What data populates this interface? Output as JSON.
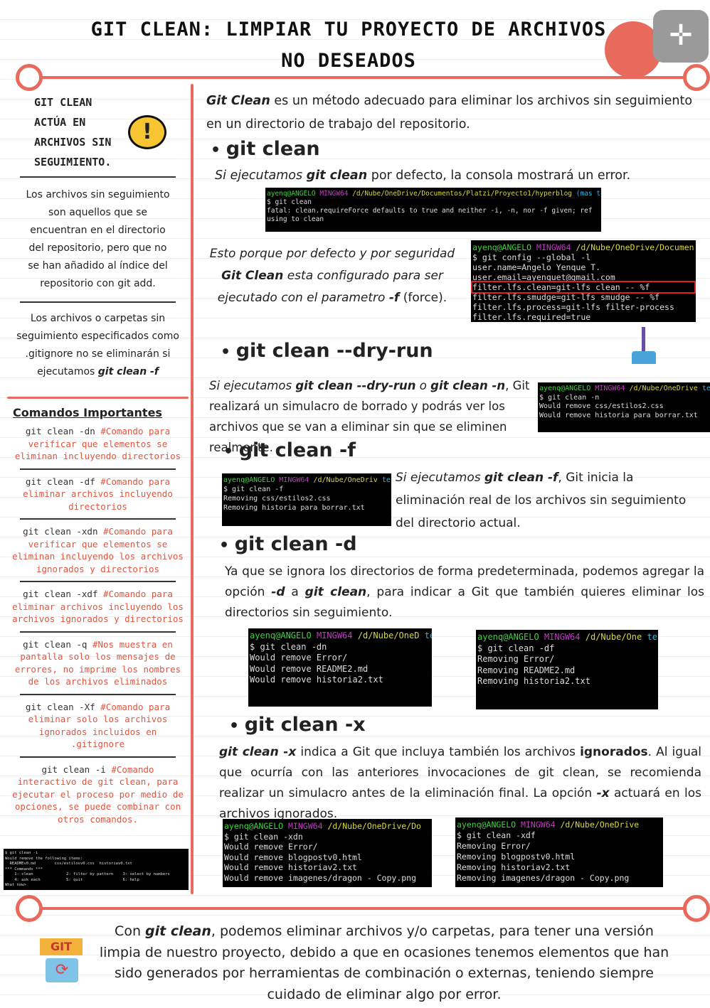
{
  "title": "GIT CLEAN: LIMPIAR TU PROYECTO DE ARCHIVOS NO DESEADOS",
  "colors": {
    "accent": "#e86a5c",
    "comment": "#e0553f",
    "terminal_bg": "#000000",
    "highlight_box": "#e02020"
  },
  "left": {
    "heading": "GIT CLEAN ACTÚA EN ARCHIVOS SIN SEGUIMIENTO.",
    "warning_icon": "exclamation-icon",
    "p1": "Los archivos sin seguimiento son aquellos que se encuentran en el directorio del repositorio, pero que no se han añadido al índice del repositorio con git add.",
    "p2a": "Los archivos o carpetas sin seguimiento especificados como .gitignore no se eliminarán si ejecutamos ",
    "p2b": "git clean -f",
    "commands_title": "Comandos Importantes",
    "commands": [
      {
        "cmd": "git clean -dn",
        "comment": "#Comando para verificar que elementos se eliminan incluyendo directorios"
      },
      {
        "cmd": "git clean -df",
        "comment": "#Comando para eliminar archivos incluyendo directorios"
      },
      {
        "cmd": "git clean -xdn",
        "comment": "#Comando para verificar que elementos se eliminan incluyendo los archivos ignorados y directorios"
      },
      {
        "cmd": "git clean -xdf",
        "comment": "#Comando para eliminar archivos incluyendo los archivos ignorados y directorios"
      },
      {
        "cmd": "git clean -q",
        "comment": "#Nos muestra en pantalla solo los mensajes de errores, no imprime los nombres de los archivos eliminados"
      },
      {
        "cmd": "git clean -Xf",
        "comment": "#Comando para eliminar solo los archivos ignorados incluidos en .gitignore"
      },
      {
        "cmd": "git clean -i",
        "comment": "#Comando interactivo de git clean, para ejecutar el proceso por medio de opciones, se puede combinar con otros comandos."
      }
    ],
    "terminal_interactive": [
      "$ git clean -i",
      "Would remove the following items:",
      "  READMEv0.md        css/estilosv0.css  historiav0.txt",
      "*** Commands ***",
      "    1: clean              2: filter by pattern    3: select by numbers",
      "    4: ask each           5: quit                 6: help",
      "What now>"
    ]
  },
  "intro": {
    "b": "Git Clean",
    "rest": " es un método adecuado para eliminar los archivos sin seguimiento en un directorio de trabajo del repositorio."
  },
  "s1": {
    "title": "git clean",
    "t1": "Si ejecutamos ",
    "b": "git clean",
    "t2": " por defecto, la consola mostrará un error.",
    "term": {
      "user": "ayenq@ANGELO",
      "host": "MINGW64",
      "path": "/d/Nube/OneDrive/Documentos/Platzi/Proyecto1/hyperblog",
      "branch": "(mas ter)",
      "lines": [
        "$ git clean",
        "fatal: clean.requireForce defaults to true and neither -i, -n, nor -f given; ref",
        "using to clean"
      ]
    },
    "note1": "Esto porque por defecto y por seguridad ",
    "note_b": "Git Clean",
    "note2": " esta configurado para ser ejecutado con el parametro ",
    "note_f": "-f",
    "note3": " (force).",
    "term2": {
      "user": "ayenq@ANGELO",
      "host": "MINGW64",
      "path": "/d/Nube/OneDrive/Documen",
      "lines": [
        "$ git config --global -l",
        "user.name=Angelo Yenque T.",
        "user.email=ayenquet@gmail.com",
        "filter.lfs.clean=git-lfs clean -- %f",
        "filter.lfs.smudge=git-lfs smudge -- %f",
        "filter.lfs.process=git-lfs filter-process",
        "filter.lfs.required=true"
      ]
    }
  },
  "s2": {
    "title": "git clean --dry-run",
    "t1": "Si ejecutamos ",
    "b1": "git clean --dry-run",
    "t2": " o ",
    "b2": "git clean -n",
    "t3": ", Git realizará un simulacro de borrado y podrás ver los archivos que se van a eliminar sin que se eliminen realmente.",
    "broom_icon": "broom-icon",
    "term": {
      "user": "ayenq@ANGELO",
      "host": "MINGW64",
      "path": "/d/Nube/OneDrive",
      "branch": "ter)",
      "lines": [
        "$ git clean -n",
        "Would remove css/estilos2.css",
        "Would remove historia para borrar.txt"
      ]
    }
  },
  "s3": {
    "title": "git clean -f",
    "t1": "Si ejecutamos ",
    "b": "git clean -f",
    "t2": ", Git inicia la eliminación real de los archivos sin seguimiento del directorio actual.",
    "term": {
      "user": "ayenq@ANGELO",
      "host": "MINGW64",
      "path": "/d/Nube/OneDriv",
      "branch": "ter)",
      "lines": [
        "$ git clean -f",
        "Removing css/estilos2.css",
        "Removing historia para borrar.txt"
      ]
    }
  },
  "s4": {
    "title": "git clean -d",
    "t1": "Ya que se ignora los directorios de forma predeterminada, podemos agregar la opción ",
    "o": "-d",
    "t2": " a ",
    "b": "git clean",
    "t3": ", para indicar a Git que también quieres eliminar los directorios sin seguimiento.",
    "term1": {
      "user": "ayenq@ANGELO",
      "host": "MINGW64",
      "path": "/d/Nube/OneD",
      "branch": "ter)",
      "lines": [
        "$ git clean -dn",
        "Would remove Error/",
        "Would remove README2.md",
        "Would remove historia2.txt"
      ]
    },
    "term2": {
      "user": "ayenq@ANGELO",
      "host": "MINGW64",
      "path": "/d/Nube/One",
      "branch": "ter)",
      "lines": [
        "$ git clean -df",
        "Removing Error/",
        "Removing README2.md",
        "Removing historia2.txt"
      ]
    }
  },
  "s5": {
    "title": "git clean -x",
    "b": "git clean -x",
    "t1": " indica a Git que incluya también los archivos ",
    "ig": "ignorados",
    "t2": ". Al igual que ocurría con las anteriores invocaciones de git clean, se recomienda realizar un simulacro antes de la eliminación final. La opción ",
    "o": "-x",
    "t3": " actuará en los archivos ignorados.",
    "term1": {
      "user": "ayenq@ANGELO",
      "host": "MINGW64",
      "path": "/d/Nube/OneDrive/Do",
      "lines": [
        "$ git clean -xdn",
        "Would remove Error/",
        "Would remove blogpostv0.html",
        "Would remove historiav2.txt",
        "Would remove imagenes/dragon - Copy.png"
      ]
    },
    "term2": {
      "user": "ayenq@ANGELO",
      "host": "MINGW64",
      "path": "/d/Nube/OneDrive",
      "lines": [
        "$ git clean -xdf",
        "Removing Error/",
        "Removing blogpostv0.html",
        "Removing historiav2.txt",
        "Removing imagenes/dragon - Copy.png"
      ]
    }
  },
  "footer": {
    "t1": "Con ",
    "b": "git clean",
    "t2": ", podemos eliminar archivos y/o carpetas, para tener una versión limpia de nuestro proyecto, debido a que en ocasiones tenemos elementos que han sido generados por herramientas de combinación o externas, teniendo siempre cuidado de eliminar algo por error.",
    "git_logo": "GIT"
  },
  "icons": {
    "github": "github-octocat-icon",
    "expand": "collapse-icon"
  }
}
